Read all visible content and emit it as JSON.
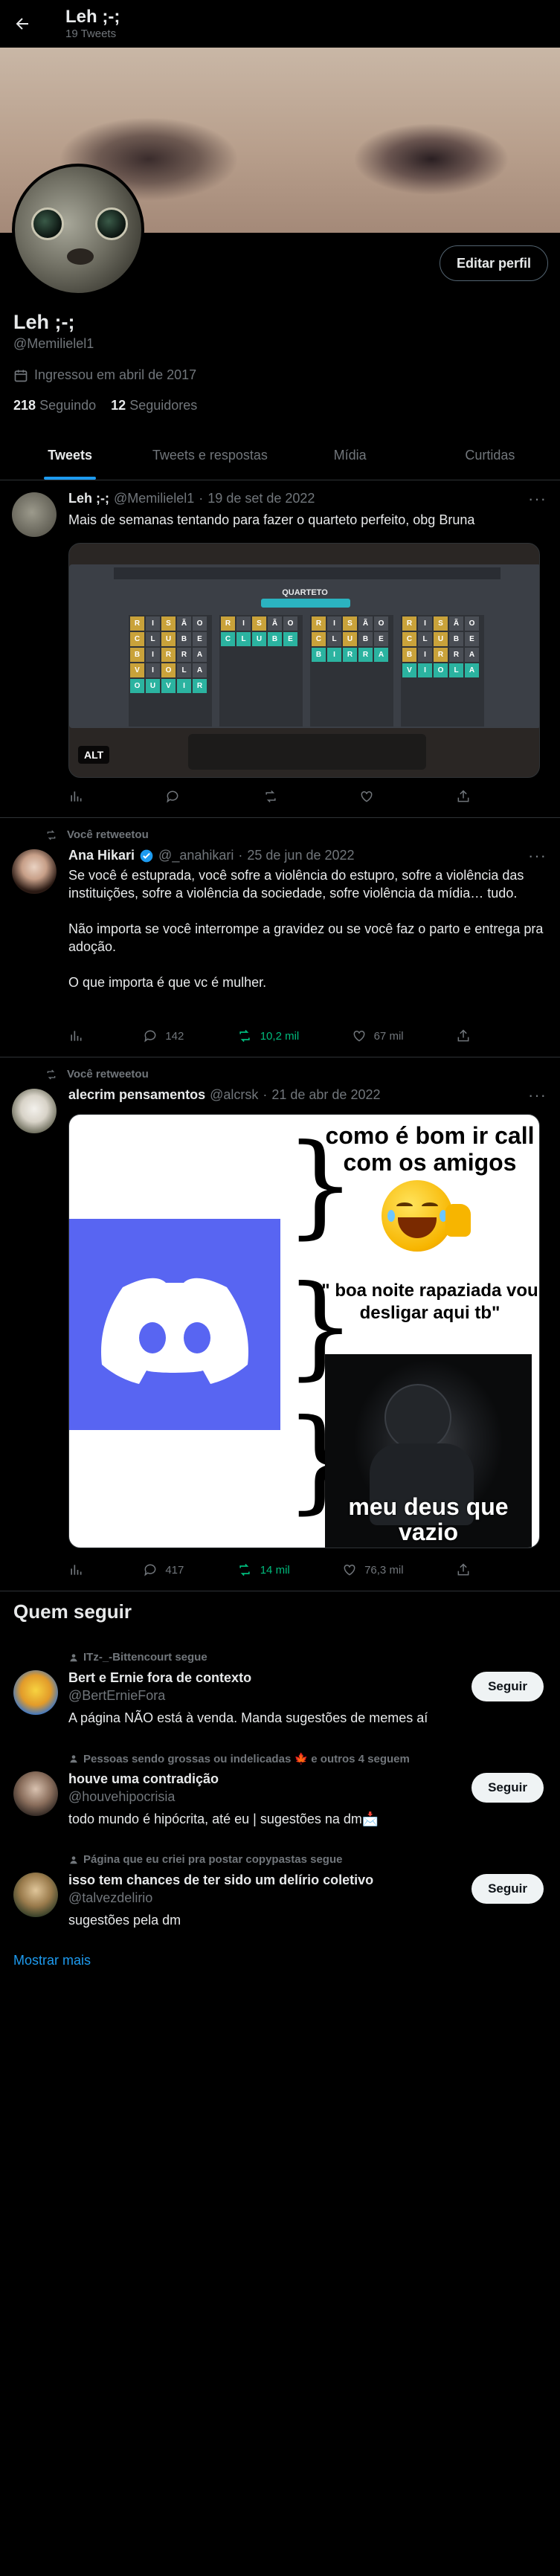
{
  "header": {
    "title": "Leh ;-;",
    "subtitle": "19 Tweets"
  },
  "profile": {
    "name": "Leh ;-;",
    "handle": "@Memilielel1",
    "joined": "Ingressou em abril de 2017",
    "following_count": "218",
    "following_label": "Seguindo",
    "followers_count": "12",
    "followers_label": "Seguidores",
    "edit_label": "Editar perfil"
  },
  "tabs": [
    {
      "label": "Tweets",
      "active": true
    },
    {
      "label": "Tweets e respostas",
      "active": false
    },
    {
      "label": "Mídia",
      "active": false
    },
    {
      "label": "Curtidas",
      "active": false
    }
  ],
  "tweets": [
    {
      "name": "Leh ;-;",
      "handle": "@Memilielel1",
      "date": "19 de set de 2022",
      "text": "Mais de semanas tentando para fazer o quarteto perfeito, obg Bruna",
      "media_title": "QUARTETO",
      "alt_label": "ALT",
      "grid_words": [
        [
          "RISÃO",
          "CLUBE",
          "BIRRA",
          "VIOLA",
          "OUVIR"
        ],
        [
          "RISÃO",
          "CLUBE"
        ],
        [
          "RISÃO",
          "CLUBE",
          "BIRRA"
        ],
        [
          "RISÃO",
          "CLUBE",
          "BIRRA",
          "VIOLA"
        ]
      ]
    },
    {
      "retweet_label": "Você retweetou",
      "name": "Ana Hikari",
      "handle": "@_anahikari",
      "date": "25 de jun de 2022",
      "paragraphs": [
        "Se você é estuprada, você sofre a violência do estupro, sofre a violência das instituições, sofre a violência da sociedade, sofre violência da mídia… tudo.",
        "Não importa se você interrompe a gravidez ou se você faz o parto e entrega pra adoção.",
        "O que importa é que vc é mulher."
      ],
      "replies": "142",
      "retweets": "10,2 mil",
      "likes": "67 mil"
    },
    {
      "retweet_label": "Você retweetou",
      "name": "alecrim pensamentos",
      "handle": "@alcrsk",
      "date": "21 de abr de 2022",
      "meme_text_1": "como é bom ir call com os amigos",
      "meme_text_2": "\" boa noite rapaziada vou desligar aqui tb\"",
      "meme_text_3": "meu deus que vazio",
      "replies": "417",
      "retweets": "14 mil",
      "likes": "76,3 mil"
    }
  ],
  "who_to_follow": {
    "title": "Quem seguir",
    "follow_label": "Seguir",
    "show_more": "Mostrar mais",
    "items": [
      {
        "context": "ITz-_-Bittencourt segue",
        "name": "Bert e Ernie fora de contexto",
        "handle": "@BertErnieFora",
        "bio": "A página NÃO está à venda. Manda sugestões de memes aí"
      },
      {
        "context": "Pessoas sendo grossas ou indelicadas 🍁 e outros 4 seguem",
        "name": "houve uma contradição",
        "handle": "@houvehipocrisia",
        "bio": "todo mundo é hipócrita, até eu | sugestões na dm📩"
      },
      {
        "context": "Página que eu criei pra postar copypastas segue",
        "name": "isso tem chances de ter sido um delírio coletivo",
        "handle": "@talvezdelirio",
        "bio": "sugestões pela dm"
      }
    ]
  },
  "colors": {
    "accent": "#1d9bf0",
    "retweet_green": "#00ba7c",
    "discord": "#5865f2"
  }
}
